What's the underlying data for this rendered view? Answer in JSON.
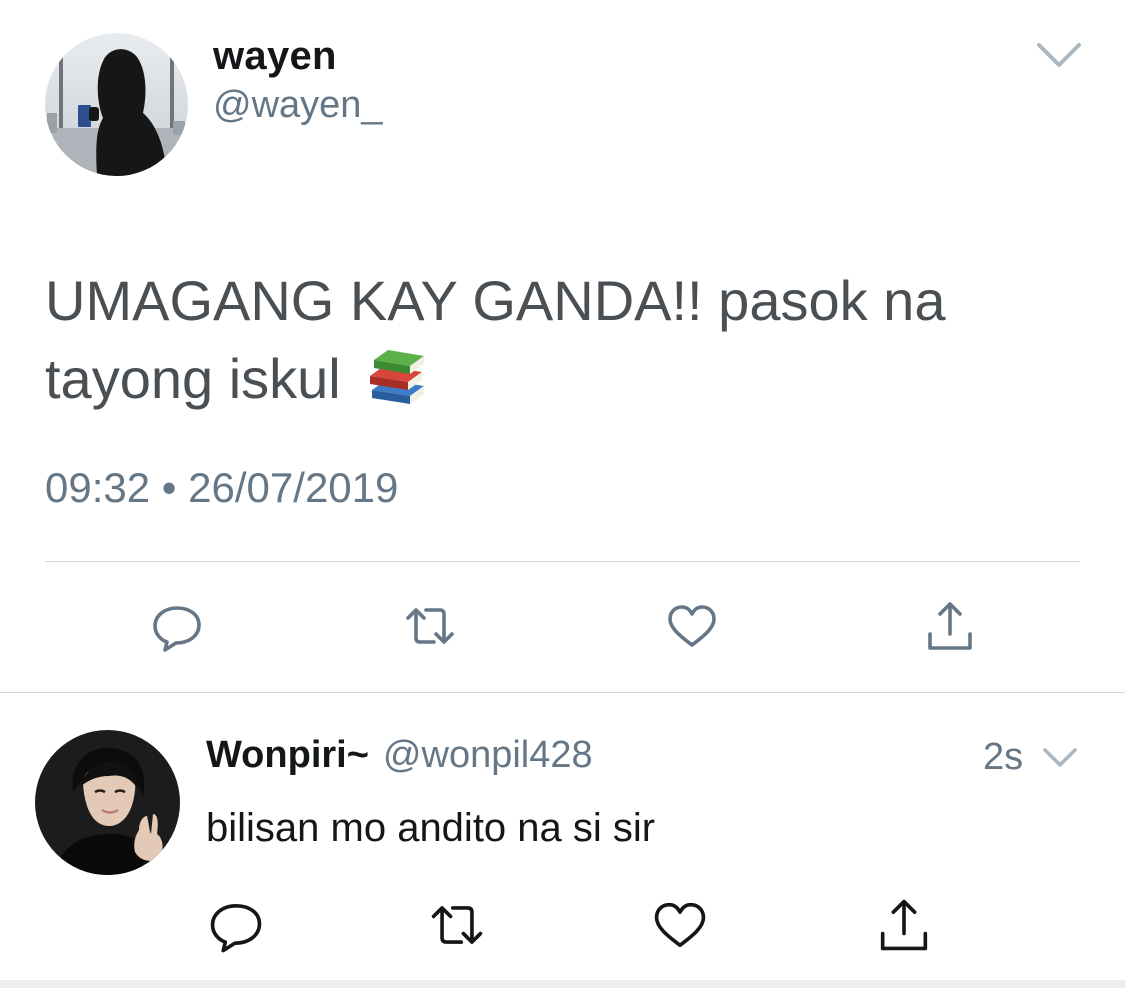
{
  "main_tweet": {
    "display_name": "wayen",
    "handle": "@wayen_",
    "text": "UMAGANG KAY GANDA!! pasok na tayong iskul",
    "emoji": "books-emoji",
    "time": "09:32",
    "separator": "•",
    "date": "26/07/2019",
    "actions": [
      "reply-icon",
      "retweet-icon",
      "like-icon",
      "share-icon"
    ]
  },
  "reply": {
    "display_name": "Wonpiri~",
    "handle": "@wonpil428",
    "time": "2s",
    "text": "bilisan mo andito na si sir",
    "actions": [
      "reply-icon",
      "retweet-icon",
      "like-icon",
      "share-icon"
    ]
  },
  "colors": {
    "text_primary": "#14171a",
    "text_secondary": "#657786",
    "divider": "#ccd6dd",
    "icon": "#657786"
  }
}
